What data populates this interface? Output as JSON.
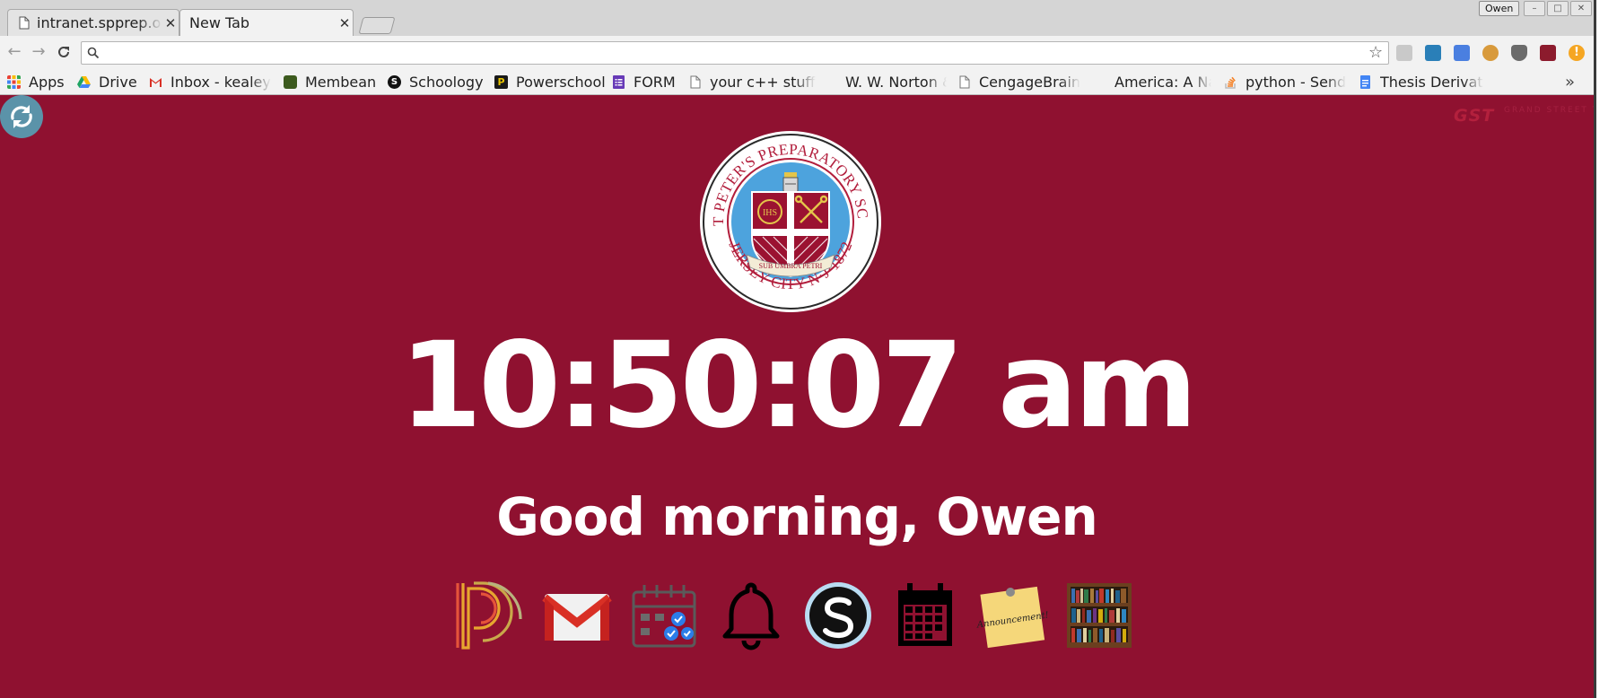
{
  "browser": {
    "tabs": [
      {
        "title": "intranet.spprep.o",
        "close": "✕",
        "active": false
      },
      {
        "title": "New Tab",
        "close": "✕",
        "active": true
      }
    ],
    "profile_name": "Owen",
    "window_controls": [
      "minimize",
      "maximize",
      "close"
    ],
    "omnibox": {
      "value": "",
      "placeholder": ""
    },
    "extensions": [
      "extension-1",
      "extension-2",
      "translate",
      "cookie",
      "ublock",
      "extension-6",
      "alert"
    ]
  },
  "bookmarks": {
    "items": [
      {
        "label": "Apps",
        "icon": "apps-grid-icon",
        "color": "#e94235"
      },
      {
        "label": "Drive",
        "icon": "drive-icon",
        "color": "#1fa463"
      },
      {
        "label": "Inbox - kealey",
        "icon": "gmail-icon",
        "color": "#d93025"
      },
      {
        "label": "Membean",
        "icon": "membean-icon",
        "color": "#3c5a1e"
      },
      {
        "label": "Schoology",
        "icon": "schoology-icon",
        "color": "#111111"
      },
      {
        "label": "Powerschool",
        "icon": "powerschool-icon",
        "color": "#1a1a1a"
      },
      {
        "label": "FORM",
        "icon": "forms-icon",
        "color": "#673ab7"
      },
      {
        "label": "your c++ stuff",
        "icon": "page-icon",
        "color": "#777777"
      },
      {
        "label": "W. W. Norton &",
        "icon": "",
        "color": ""
      },
      {
        "label": "CengageBrain",
        "icon": "page-icon",
        "color": "#777777"
      },
      {
        "label": "America: A Nar",
        "icon": "",
        "color": ""
      },
      {
        "label": "python - Send",
        "icon": "stackoverflow-icon",
        "color": "#f48024"
      },
      {
        "label": "Thesis Derivat",
        "icon": "docs-icon",
        "color": "#4285f4"
      }
    ],
    "overflow": "»"
  },
  "page": {
    "background": "#8f1130",
    "clock": "10:50:07 am",
    "greeting": "Good morning, Owen",
    "brand_logo": {
      "mark": "GST",
      "text": "GRAND STREET TECHNOLOGIES"
    },
    "seal": {
      "top_text": "SAINT PETER'S PREPARATORY SCHOOL",
      "bottom_text": "JERSEY CITY N·J·1872",
      "motto": "SUB UMBRA PETRI",
      "monogram": "IHS"
    },
    "apps": [
      {
        "name": "PowerSchool",
        "icon": "powerschool-icon"
      },
      {
        "name": "Gmail",
        "icon": "gmail-icon"
      },
      {
        "name": "Calendar",
        "icon": "calendar-check-icon"
      },
      {
        "name": "Bell Schedule",
        "icon": "bell-icon"
      },
      {
        "name": "Schoology",
        "icon": "schoology-icon"
      },
      {
        "name": "Calendar",
        "icon": "calendar-icon"
      },
      {
        "name": "Announcement!",
        "icon": "announcement-note-icon",
        "note_text": "Announcement!"
      },
      {
        "name": "Library",
        "icon": "bookshelf-icon"
      }
    ]
  }
}
